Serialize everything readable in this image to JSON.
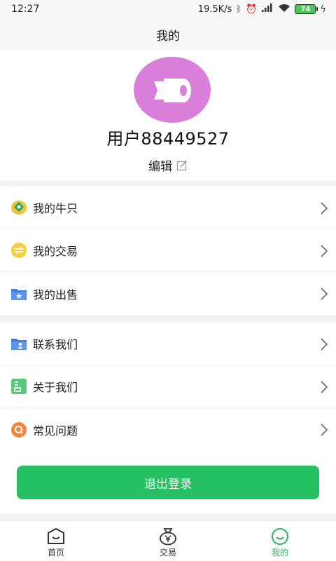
{
  "status_bar": {
    "time": "12:27",
    "network_speed": "19.5K/s",
    "battery": "74",
    "icons": [
      "bluetooth-icon",
      "alarm-icon",
      "hd-signal-icon",
      "wifi-icon",
      "battery-icon",
      "charging-icon"
    ]
  },
  "header": {
    "title": "我的"
  },
  "profile": {
    "username": "用户88449527",
    "edit_label": "编辑",
    "avatar_color": "#d97fd9"
  },
  "menu_group1": [
    {
      "label": "我的牛只",
      "icon": "cattle-icon"
    },
    {
      "label": "我的交易",
      "icon": "exchange-icon"
    },
    {
      "label": "我的出售",
      "icon": "sale-folder-icon"
    }
  ],
  "menu_group2": [
    {
      "label": "联系我们",
      "icon": "contact-folder-icon"
    },
    {
      "label": "关于我们",
      "icon": "about-icon"
    },
    {
      "label": "常见问题",
      "icon": "faq-icon"
    }
  ],
  "logout_label": "退出登录",
  "tabs": [
    {
      "label": "首页",
      "icon": "home-icon",
      "active": false
    },
    {
      "label": "交易",
      "icon": "trade-money-bag-icon",
      "active": false
    },
    {
      "label": "我的",
      "icon": "profile-smile-icon",
      "active": true
    }
  ],
  "colors": {
    "accent": "#25c061",
    "active_tab": "#22b45a"
  }
}
